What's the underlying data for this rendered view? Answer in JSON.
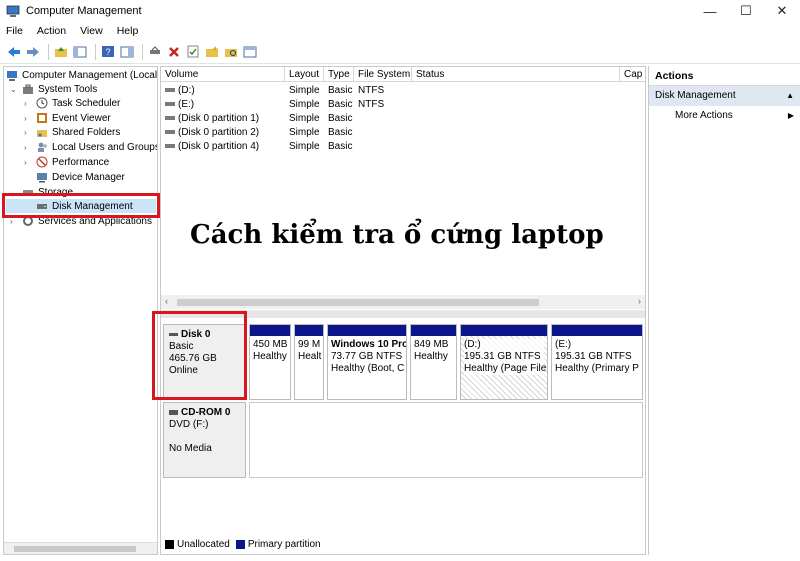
{
  "window": {
    "title": "Computer Management",
    "minimize": "—",
    "maximize": "☐",
    "close": "✕"
  },
  "menu": [
    "File",
    "Action",
    "View",
    "Help"
  ],
  "tree": {
    "root": "Computer Management (Local",
    "system_tools": "System Tools",
    "task_scheduler": "Task Scheduler",
    "event_viewer": "Event Viewer",
    "shared_folders": "Shared Folders",
    "local_users": "Local Users and Groups",
    "performance": "Performance",
    "device_manager": "Device Manager",
    "storage": "Storage",
    "disk_management": "Disk Management",
    "services": "Services and Applications"
  },
  "volume_table": {
    "headers": [
      "Volume",
      "Layout",
      "Type",
      "File System",
      "Status",
      "Cap"
    ],
    "rows": [
      {
        "volume": "(D:)",
        "layout": "Simple",
        "type": "Basic",
        "fs": "NTFS"
      },
      {
        "volume": "(E:)",
        "layout": "Simple",
        "type": "Basic",
        "fs": "NTFS"
      },
      {
        "volume": "(Disk 0 partition 1)",
        "layout": "Simple",
        "type": "Basic",
        "fs": ""
      },
      {
        "volume": "(Disk 0 partition 2)",
        "layout": "Simple",
        "type": "Basic",
        "fs": ""
      },
      {
        "volume": "(Disk 0 partition 4)",
        "layout": "Simple",
        "type": "Basic",
        "fs": ""
      }
    ]
  },
  "disk0": {
    "name": "Disk 0",
    "type": "Basic",
    "size": "465.76 GB",
    "status": "Online",
    "partitions": [
      {
        "title": "",
        "size": "450 MB",
        "status": "Healthy"
      },
      {
        "title": "",
        "size": "99 M",
        "status": "Healt"
      },
      {
        "title": "Windows 10 Pro",
        "size": "73.77 GB NTFS",
        "status": "Healthy (Boot, C"
      },
      {
        "title": "",
        "size": "849 MB",
        "status": "Healthy"
      },
      {
        "title": "(D:)",
        "size": "195.31 GB NTFS",
        "status": "Healthy (Page File,"
      },
      {
        "title": "(E:)",
        "size": "195.31 GB NTFS",
        "status": "Healthy (Primary P"
      }
    ]
  },
  "cdrom": {
    "name": "CD-ROM 0",
    "drive": "DVD (F:)",
    "status": "No Media"
  },
  "legend": {
    "unallocated": "Unallocated",
    "primary": "Primary partition"
  },
  "actions": {
    "header": "Actions",
    "section": "Disk Management",
    "more": "More Actions"
  },
  "overlay_caption": "Cách kiểm tra ổ cứng laptop",
  "colors": {
    "partition_bar": "#0d158a",
    "highlight_box": "#d6171f",
    "actions_section_bg": "#dfe7f2"
  }
}
